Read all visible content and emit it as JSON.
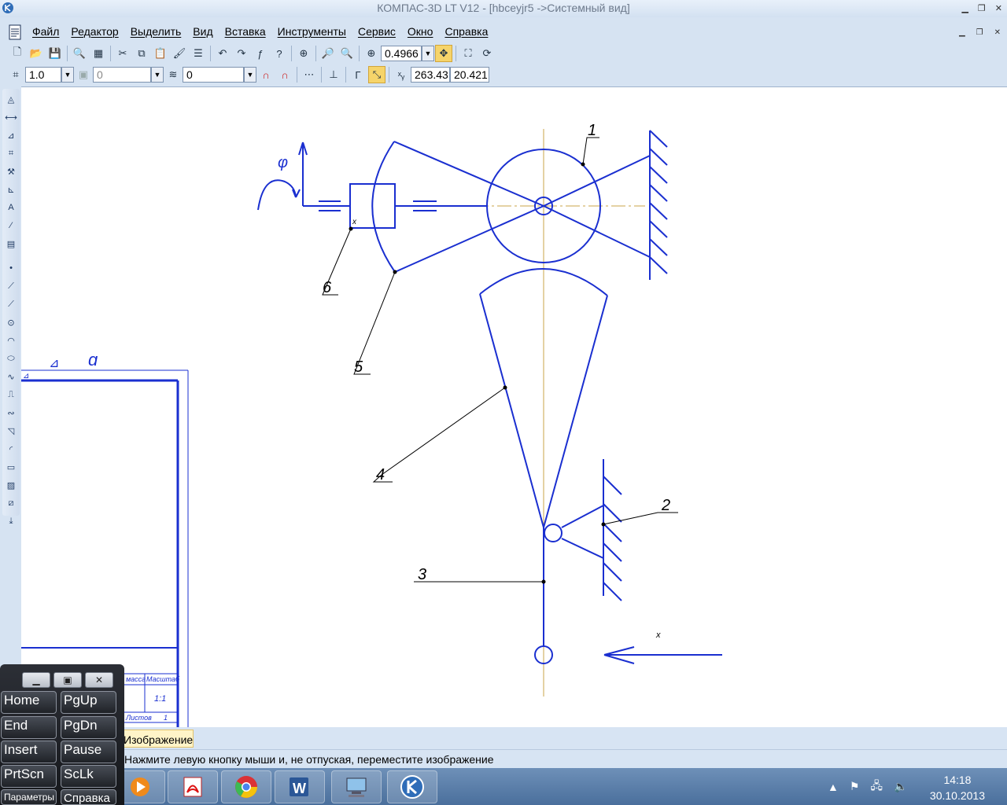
{
  "window": {
    "title": "КОМПАС-3D LT V12 - [hbceyjr5 ->Системный вид]"
  },
  "menu": {
    "items": [
      "Файл",
      "Редактор",
      "Выделить",
      "Вид",
      "Вставка",
      "Инструменты",
      "Сервис",
      "Окно",
      "Справка"
    ]
  },
  "toolbar1": {
    "zoom_value": "0.4966"
  },
  "toolbar2": {
    "line_scale": "1.0",
    "layer_value": "0",
    "style_value": "0",
    "coord_x": "263.43",
    "coord_y": "20.421"
  },
  "drawing": {
    "callouts": [
      "1",
      "2",
      "3",
      "4",
      "5",
      "6"
    ],
    "greek_top": "φ",
    "axis_x_small": "x",
    "axis_x_bottom": "x",
    "frame_letters": [
      "⊿",
      "ɑ"
    ],
    "title_block": {
      "col_masса": "масса",
      "col_scale": "Масштаб",
      "scale_value": "1:1",
      "sheets_label": "Листов",
      "sheets_value": "1"
    }
  },
  "tab": {
    "label": "Изображение"
  },
  "status": {
    "message": "Нажмите левую кнопку мыши и, не отпуская, переместите изображение"
  },
  "keyboard": {
    "keys": [
      [
        "Home",
        "PgUp"
      ],
      [
        "End",
        "PgDn"
      ],
      [
        "Insert",
        "Pause"
      ],
      [
        "PrtScn",
        "ScLk"
      ],
      [
        "Параметры",
        "Справка"
      ]
    ]
  },
  "taskbar": {
    "time": "14:18",
    "date": "30.10.2013"
  },
  "colors": {
    "drawing_line": "#1a2fd0",
    "axis_line": "#c9a44a",
    "leader_line": "#000000"
  }
}
